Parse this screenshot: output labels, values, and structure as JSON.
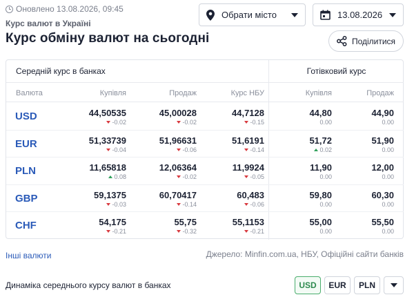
{
  "header": {
    "updated": "Оновлено 13.08.2026, 09:45",
    "breadcrumb": "Курс валют в Україні",
    "title": "Курс обміну валют на сьогодні",
    "city_select": "Обрати місто",
    "date_select": "13.08.2026",
    "share_label": "Поділитися"
  },
  "table": {
    "group_bank": "Середній курс в банках",
    "group_cash": "Готівковий курс",
    "columns": [
      "Валюта",
      "Купівля",
      "Продаж",
      "Курс НБУ",
      "Купівля",
      "Продаж"
    ],
    "rows": [
      {
        "code": "USD",
        "buy": {
          "v": "44,50535",
          "d": "-0.02",
          "dir": "down"
        },
        "sell": {
          "v": "45,00028",
          "d": "-0.02",
          "dir": "down"
        },
        "nbu": {
          "v": "44,7128",
          "d": "-0.15",
          "dir": "down"
        },
        "cash_buy": {
          "v": "44,80",
          "d": "0.00",
          "dir": "none"
        },
        "cash_sell": {
          "v": "44,90",
          "d": "0.00",
          "dir": "none"
        }
      },
      {
        "code": "EUR",
        "buy": {
          "v": "51,33739",
          "d": "-0.04",
          "dir": "down"
        },
        "sell": {
          "v": "51,96631",
          "d": "-0.06",
          "dir": "down"
        },
        "nbu": {
          "v": "51,6191",
          "d": "-0.14",
          "dir": "down"
        },
        "cash_buy": {
          "v": "51,72",
          "d": "0.02",
          "dir": "up"
        },
        "cash_sell": {
          "v": "51,90",
          "d": "0.00",
          "dir": "none"
        }
      },
      {
        "code": "PLN",
        "buy": {
          "v": "11,65818",
          "d": "0.08",
          "dir": "up"
        },
        "sell": {
          "v": "12,06364",
          "d": "-0.02",
          "dir": "down"
        },
        "nbu": {
          "v": "11,9924",
          "d": "-0.05",
          "dir": "down"
        },
        "cash_buy": {
          "v": "11,90",
          "d": "0.00",
          "dir": "none"
        },
        "cash_sell": {
          "v": "12,00",
          "d": "0.00",
          "dir": "none"
        }
      },
      {
        "code": "GBP",
        "buy": {
          "v": "59,1375",
          "d": "-0.03",
          "dir": "down"
        },
        "sell": {
          "v": "60,70417",
          "d": "-0.14",
          "dir": "down"
        },
        "nbu": {
          "v": "60,483",
          "d": "-0.06",
          "dir": "down"
        },
        "cash_buy": {
          "v": "59,80",
          "d": "0.00",
          "dir": "none"
        },
        "cash_sell": {
          "v": "60,30",
          "d": "0.00",
          "dir": "none"
        }
      },
      {
        "code": "CHF",
        "buy": {
          "v": "54,175",
          "d": "-0.21",
          "dir": "down"
        },
        "sell": {
          "v": "55,75",
          "d": "-0.32",
          "dir": "down"
        },
        "nbu": {
          "v": "55,1153",
          "d": "-0.21",
          "dir": "down"
        },
        "cash_buy": {
          "v": "55,00",
          "d": "0.00",
          "dir": "none"
        },
        "cash_sell": {
          "v": "55,50",
          "d": "0.00",
          "dir": "none"
        }
      }
    ]
  },
  "footer": {
    "other_link": "Інші валюти",
    "source": "Джерело: Minfin.com.ua, НБУ, Офіційні сайти банків",
    "dynamics_title": "Динаміка середнього курсу валют в банках",
    "chips": [
      "USD",
      "EUR",
      "PLN"
    ],
    "active_chip": "USD"
  },
  "colors": {
    "accent": "#2a5ab8",
    "down": "#d8393f",
    "up": "#2fa05a",
    "active_chip": "#49ad6c"
  }
}
